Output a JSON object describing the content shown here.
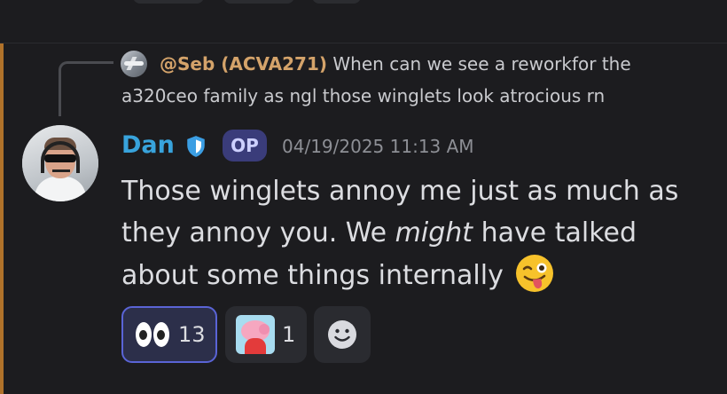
{
  "reply": {
    "author": "@Seb (ACVA271)",
    "text_line1": "When can we see a reworkfor the",
    "text_line2": "a320ceo family as ngl those winglets look atrocious rn"
  },
  "message": {
    "username": "Dan",
    "badge": "OP",
    "timestamp": "04/19/2025 11:13 AM",
    "text_before": "Those winglets annoy me just as much as they annoy you. We ",
    "text_emphasis": "might",
    "text_after": " have talked about some things internally",
    "emoji": "winking-tongue-icon"
  },
  "reactions": [
    {
      "emoji": "eyes-icon",
      "count": "13",
      "selected": true
    },
    {
      "emoji": "peppa-pig-icon",
      "count": "1",
      "selected": false
    }
  ],
  "colors": {
    "background": "#1c1c1f",
    "username": "#38a3dc",
    "reply_author": "#d4a36a",
    "op_badge": "#3a3c7a",
    "highlight_bar": "#b0722a",
    "selected_reaction_border": "#5a64d6"
  }
}
